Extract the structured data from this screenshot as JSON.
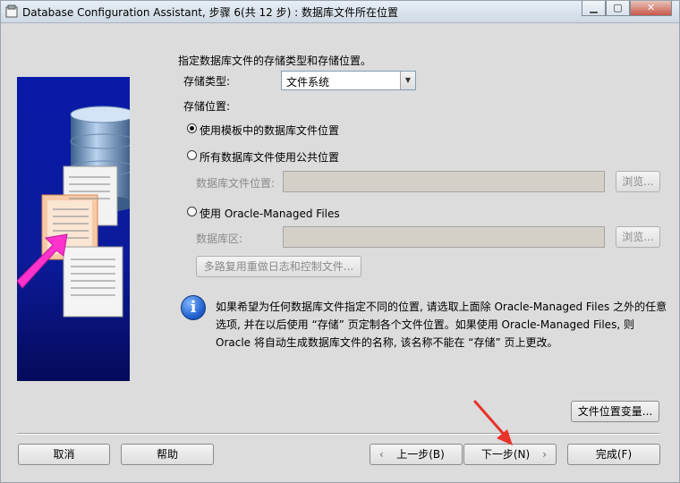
{
  "window": {
    "title": "Database Configuration Assistant, 步骤 6(共 12 步) : 数据库文件所在位置",
    "minimize_icon": "minimize-icon",
    "maximize_icon": "maximize-icon",
    "close_icon": "close-icon"
  },
  "main": {
    "heading": "指定数据库文件的存储类型和存储位置。",
    "storage_type_label": "存储类型:",
    "storage_type_value": "文件系统",
    "storage_location_label": "存储位置:",
    "option_template": "使用模板中的数据库文件位置",
    "option_common": "所有数据库文件使用公共位置",
    "db_file_location_label": "数据库文件位置:",
    "db_file_location_value": "",
    "browse_label_1": "浏览...",
    "option_omf": "使用 Oracle-Managed Files",
    "db_area_label": "数据库区:",
    "db_area_value": "",
    "browse_label_2": "浏览...",
    "multiplex_button": "多路复用重做日志和控制文件...",
    "selected_option": "template"
  },
  "info": {
    "icon": "info-icon",
    "line1": "如果希望为任何数据库文件指定不同的位置, 请选取上面除 Oracle-Managed Files 之外的任意",
    "line2": "选项, 并在以后使用 “存储” 页定制各个文件位置。如果使用 Oracle-Managed Files, 则",
    "line3": "Oracle 将自动生成数据库文件的名称, 该名称不能在 “存储” 页上更改。"
  },
  "buttons": {
    "file_location_vars": "文件位置变量...",
    "cancel": "取消",
    "help": "帮助",
    "back": "上一步(B)",
    "next": "下一步(N)",
    "finish": "完成(F)"
  },
  "colors": {
    "panel_background": "#d4d0c8",
    "illustration_blue": "#0a1aa8",
    "arrow_magenta": "#ff33cc",
    "annotation_red": "#e8322a"
  }
}
